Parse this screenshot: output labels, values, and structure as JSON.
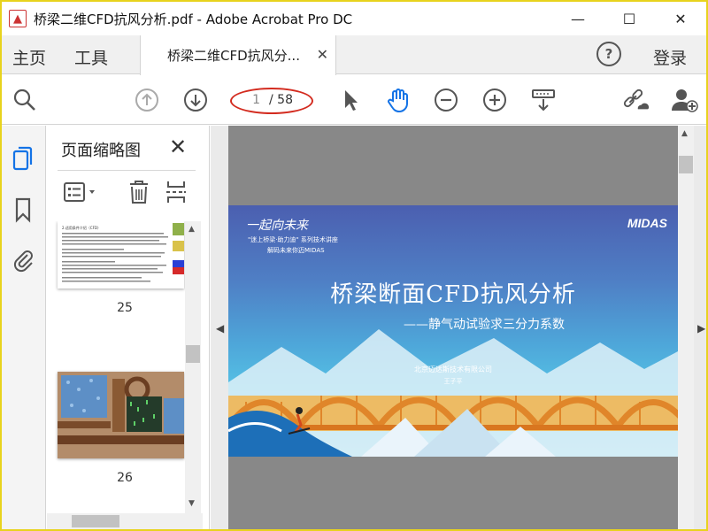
{
  "window": {
    "title": "桥梁二维CFD抗风分析.pdf - Adobe Acrobat Pro DC",
    "controls": {
      "minimize": "—",
      "maximize": "☐",
      "close": "✕"
    }
  },
  "tabs": {
    "home": "主页",
    "tools": "工具",
    "document": "桥梁二维CFD抗风分...",
    "help": "?",
    "login": "登录"
  },
  "toolbar": {
    "current_page": "1",
    "total_pages": "/ 58",
    "icons": [
      "search-icon",
      "page-up-icon",
      "page-down-icon",
      "select-arrow-icon",
      "hand-tool-icon",
      "zoom-out-icon",
      "zoom-in-icon",
      "keyboard-scroll-icon",
      "share-link-icon",
      "add-user-icon"
    ]
  },
  "rail": {
    "icons": [
      "page-thumbnails-icon",
      "bookmark-icon",
      "attachment-icon"
    ]
  },
  "thumbnail_panel": {
    "title": "页面缩略图",
    "close": "✕",
    "pages": [
      {
        "number": "25"
      },
      {
        "number": "26"
      }
    ],
    "thumb25_heading": "2.适用条件介绍（CFD）"
  },
  "slide": {
    "brand": "一起向未来",
    "tag1": "\"迷上桥梁·助力迪\" 系列技术讲座",
    "tag2": "解码未来你迈MIDAS",
    "logo": "MIDAS",
    "title": "桥梁断面CFD抗风分析",
    "subtitle": "——静气动试验求三分力系数",
    "company": "北京迈达斯技术有限公司",
    "author": "王子平"
  },
  "colors": {
    "accent": "#1473e6",
    "annotation": "#d32b1f",
    "frame": "#e8d31d"
  }
}
